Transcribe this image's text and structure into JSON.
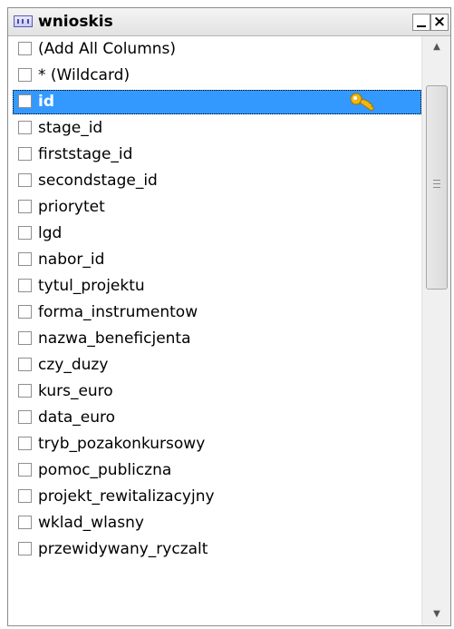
{
  "window": {
    "title": "wnioskis",
    "minimize_glyph": "_",
    "close_glyph": "×"
  },
  "columns": [
    {
      "label": "(Add All Columns)"
    },
    {
      "label": "* (Wildcard)"
    },
    {
      "label": "id",
      "selected": true,
      "primary_key": true
    },
    {
      "label": "stage_id"
    },
    {
      "label": "firststage_id"
    },
    {
      "label": "secondstage_id"
    },
    {
      "label": "priorytet"
    },
    {
      "label": "lgd"
    },
    {
      "label": "nabor_id"
    },
    {
      "label": "tytul_projektu"
    },
    {
      "label": "forma_instrumentow"
    },
    {
      "label": "nazwa_beneficjenta"
    },
    {
      "label": "czy_duzy"
    },
    {
      "label": "kurs_euro"
    },
    {
      "label": "data_euro"
    },
    {
      "label": "tryb_pozakonkursowy"
    },
    {
      "label": "pomoc_publiczna"
    },
    {
      "label": "projekt_rewitalizacyjny"
    },
    {
      "label": "wklad_wlasny"
    },
    {
      "label": "przewidywany_ryczalt"
    }
  ],
  "scrollbar": {
    "up_arrow": "▲",
    "down_arrow": "▼"
  },
  "colors": {
    "selection": "#3399ff",
    "key_icon": "#f2b70e"
  }
}
